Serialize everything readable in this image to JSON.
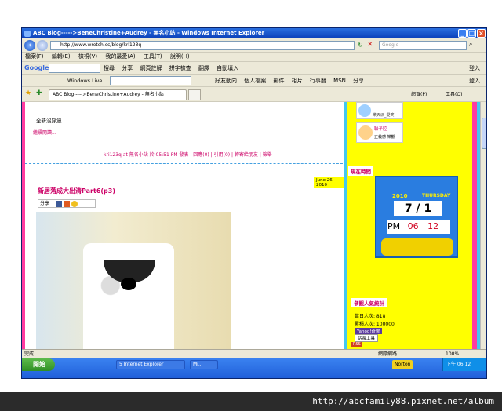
{
  "window": {
    "title": "ABC Blog----->BeneChristine+Audrey - 無名小站 - Windows Internet Explorer",
    "controls": [
      "_",
      "□",
      "×"
    ]
  },
  "nav": {
    "address": "http://www.wretch.cc/blog/kri123q",
    "search_placeholder": "Google"
  },
  "menu": [
    "檔案(F)",
    "編輯(E)",
    "檢視(V)",
    "我的最愛(A)",
    "工具(T)",
    "說明(H)"
  ],
  "google_toolbar": {
    "label": "Google",
    "items": [
      "搜尋",
      "分享",
      "網頁註解",
      "拼字檢查",
      "翻譯",
      "自動填入"
    ],
    "signin": "登入"
  },
  "wl_toolbar": {
    "label": "Windows Live",
    "items": [
      "好友動向",
      "個人檔案",
      "郵件",
      "相片",
      "行事曆",
      "MSN",
      "分享"
    ],
    "signin": "登入"
  },
  "tab": {
    "label": "ABC Blog----->BeneChristine+Audrey - 無名小站",
    "right_items": [
      "網頁(P)",
      "工具(O)"
    ]
  },
  "blog": {
    "intro_text": "全新沒穿過",
    "continue_link": "繼續閱讀...",
    "meta_line": "kri123q at 無名小站 於 05:51 PM 發表 | 回應(0) | 引用(0) | 轉寄給朋友 | 檢舉",
    "post_date": "June 26, 2010",
    "post_title": "新居落成大出清Part6(p3)",
    "share_label": "分享"
  },
  "sidebar": {
    "friends": [
      {
        "name": "樂天派_愛笑"
      },
      {
        "name": "聯子腔",
        "caption": "正義感 樂觀"
      }
    ],
    "time_heading": "現在時間",
    "clock": {
      "year": "2010",
      "weekday": "THURSDAY",
      "month": "7",
      "day": "1",
      "ampm": "PM",
      "hour": "06",
      "minute": "12"
    },
    "visitors_heading": "參觀人氣統計",
    "today": "當日人次: 818",
    "total": "累積人次: 100000",
    "yahoo": "Yahoo!奇摩",
    "tools": "站長工具",
    "rss": "RSS"
  },
  "status": {
    "text": "完成",
    "zone": "網際網路",
    "zoom": "100%"
  },
  "taskbar": {
    "start": "開始",
    "tasks": [
      "5 Internet Explorer",
      "Mi..."
    ],
    "norton": "Norton",
    "clock": "下午 06:12"
  },
  "caption_url": "http://abcfamily88.pixnet.net/album",
  "colors": {
    "titlebar": "#0a3fb8",
    "sidebar_bg": "#ffff00",
    "accent_pink": "#cc0066",
    "strip_pink": "#ff3ca0",
    "strip_blue": "#44c8f0"
  }
}
